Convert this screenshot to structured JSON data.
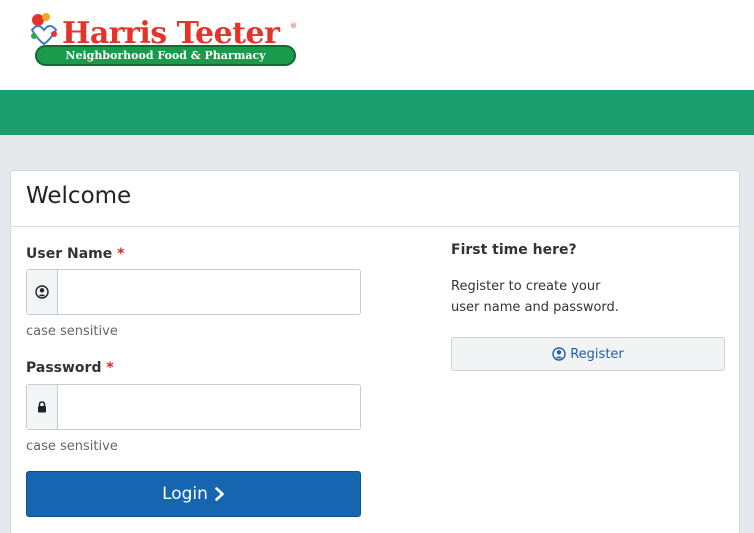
{
  "brand": {
    "name": "Harris Teeter",
    "registered_mark": "®",
    "tagline": "Neighborhood Food & Pharmacy"
  },
  "panel": {
    "title": "Welcome"
  },
  "login_form": {
    "username_label": "User Name",
    "username_value": "",
    "username_hint": "case sensitive",
    "password_label": "Password",
    "password_value": "",
    "password_hint": "case sensitive",
    "required_marker": "*",
    "login_label": "Login"
  },
  "register_section": {
    "title": "First time here?",
    "line1": "Register to create your",
    "line2": "user name and password.",
    "button_label": "Register"
  },
  "icons": {
    "user": "user-circle-icon",
    "lock": "lock-icon",
    "chevron": "chevron-right-icon"
  },
  "colors": {
    "brand_red": "#e5332a",
    "brand_green": "#1a9b4b",
    "nav_green": "#1a9e6e",
    "login_blue": "#1565b0",
    "required_red": "#d9232e"
  }
}
